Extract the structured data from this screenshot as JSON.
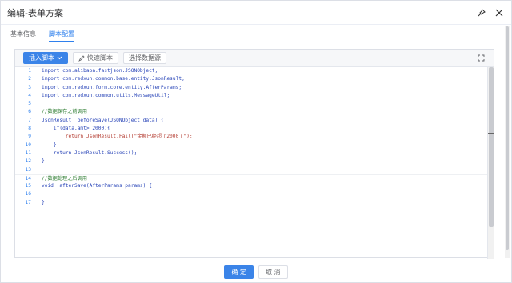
{
  "dialog": {
    "title": "编辑-表单方案",
    "pin_icon": "pin-icon",
    "close_icon": "close-icon"
  },
  "tabs": [
    {
      "label": "基本信息",
      "active": false
    },
    {
      "label": "脚本配置",
      "active": true
    }
  ],
  "toolbar": {
    "insert_label": "插入脚本",
    "quick_label": "快速脚本",
    "datasource_label": "选择数据源",
    "expand_icon": "expand-icon"
  },
  "code_lines": [
    {
      "n": "1",
      "text": "import com.alibaba.fastjson.JSONObject;"
    },
    {
      "n": "2",
      "text": "import com.redxun.common.base.entity.JsonResult;"
    },
    {
      "n": "3",
      "text": "import com.redxun.form.core.entity.AfterParams;"
    },
    {
      "n": "4",
      "text": "import com.redxun.common.utils.MessageUtil;"
    },
    {
      "n": "5",
      "text": ""
    },
    {
      "n": "6",
      "text": "//数据保存之前调用"
    },
    {
      "n": "7",
      "text": "JsonResult  beforeSave(JSONObject data) {"
    },
    {
      "n": "8",
      "text": "    if(data.amt> 2000){"
    },
    {
      "n": "9",
      "text": "        return JsonResult.Fail(\"金额已经超了2000了\");"
    },
    {
      "n": "10",
      "text": "    }"
    },
    {
      "n": "11",
      "text": "    return JsonResult.Success();"
    },
    {
      "n": "12",
      "text": "}"
    },
    {
      "n": "13",
      "text": ""
    },
    {
      "n": "14",
      "text": "//数据处理之后调用"
    },
    {
      "n": "15",
      "text": "void  afterSave(AfterParams params) {"
    },
    {
      "n": "16",
      "text": ""
    },
    {
      "n": "17",
      "text": "}"
    }
  ],
  "footer": {
    "ok_label": "确 定",
    "cancel_label": "取 消"
  },
  "colors": {
    "primary": "#3b84e8",
    "keyword": "#2945b8",
    "string": "#b33a2f",
    "comment": "#2e7d32"
  }
}
